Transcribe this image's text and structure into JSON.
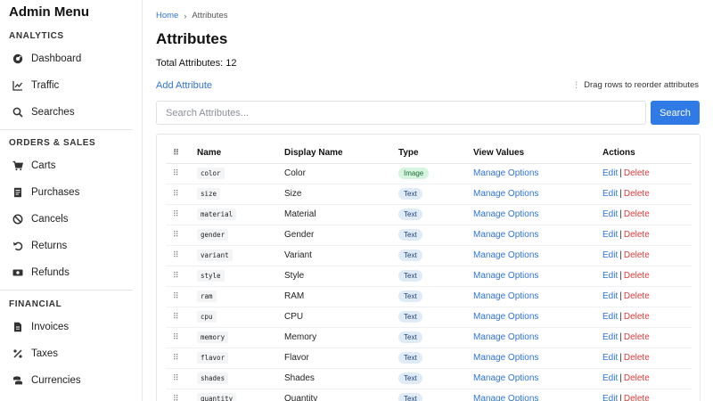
{
  "sidebar": {
    "title": "Admin Menu",
    "sections": [
      {
        "label": "ANALYTICS",
        "items": [
          {
            "label": "Dashboard",
            "icon": "dashboard-icon"
          },
          {
            "label": "Traffic",
            "icon": "chart-line-icon"
          },
          {
            "label": "Searches",
            "icon": "search-icon"
          }
        ]
      },
      {
        "label": "ORDERS & SALES",
        "items": [
          {
            "label": "Carts",
            "icon": "cart-icon"
          },
          {
            "label": "Purchases",
            "icon": "receipt-icon"
          },
          {
            "label": "Cancels",
            "icon": "ban-icon"
          },
          {
            "label": "Returns",
            "icon": "undo-icon"
          },
          {
            "label": "Refunds",
            "icon": "money-icon"
          }
        ]
      },
      {
        "label": "FINANCIAL",
        "items": [
          {
            "label": "Invoices",
            "icon": "invoice-icon"
          },
          {
            "label": "Taxes",
            "icon": "percent-icon"
          },
          {
            "label": "Currencies",
            "icon": "coins-icon"
          }
        ]
      }
    ]
  },
  "breadcrumb": {
    "home": "Home",
    "separator": "›",
    "current": "Attributes"
  },
  "page": {
    "title": "Attributes",
    "total": "Total Attributes: 12",
    "add_link": "Add Attribute",
    "drag_hint": "Drag rows to reorder attributes"
  },
  "search": {
    "placeholder": "Search Attributes...",
    "value": "",
    "button": "Search"
  },
  "table": {
    "headers": {
      "grip": "⠿",
      "name": "Name",
      "display": "Display Name",
      "type": "Type",
      "view": "View Values",
      "actions": "Actions"
    },
    "view_label": "Manage Options",
    "edit_label": "Edit",
    "delete_label": "Delete",
    "separator": "|",
    "rows": [
      {
        "name": "color",
        "display": "Color",
        "type": "Image"
      },
      {
        "name": "size",
        "display": "Size",
        "type": "Text"
      },
      {
        "name": "material",
        "display": "Material",
        "type": "Text"
      },
      {
        "name": "gender",
        "display": "Gender",
        "type": "Text"
      },
      {
        "name": "variant",
        "display": "Variant",
        "type": "Text"
      },
      {
        "name": "style",
        "display": "Style",
        "type": "Text"
      },
      {
        "name": "ram",
        "display": "RAM",
        "type": "Text"
      },
      {
        "name": "cpu",
        "display": "CPU",
        "type": "Text"
      },
      {
        "name": "memory",
        "display": "Memory",
        "type": "Text"
      },
      {
        "name": "flavor",
        "display": "Flavor",
        "type": "Text"
      },
      {
        "name": "shades",
        "display": "Shades",
        "type": "Text"
      },
      {
        "name": "quantity",
        "display": "Quantity",
        "type": "Text"
      }
    ]
  },
  "colors": {
    "accent": "#2f7ae5",
    "link": "#2f74d8",
    "danger": "#e03b3b",
    "badge_image_bg": "#d6f5df",
    "badge_text_bg": "#e0ebf8"
  }
}
